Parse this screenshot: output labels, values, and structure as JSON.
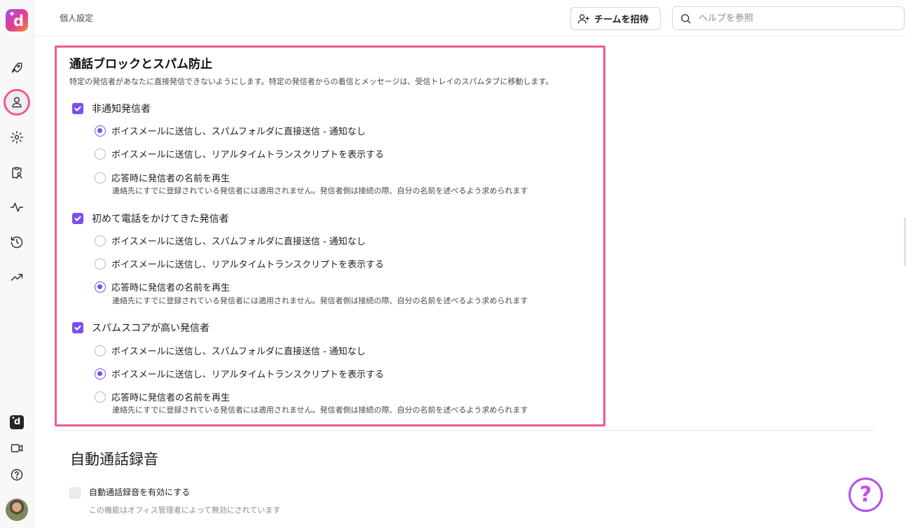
{
  "header": {
    "page_title": "個人設定",
    "invite_label": "チームを招待",
    "search_placeholder": "ヘルプを参照"
  },
  "sidebar": {
    "items": [
      {
        "icon": "rocket-icon"
      },
      {
        "icon": "user-icon",
        "active": true
      },
      {
        "icon": "gear-icon"
      },
      {
        "icon": "clipboard-user-icon"
      },
      {
        "icon": "activity-icon"
      },
      {
        "icon": "history-icon"
      },
      {
        "icon": "trending-up-icon"
      }
    ],
    "bottom": [
      {
        "icon": "dialpad-app-icon"
      },
      {
        "icon": "video-icon"
      },
      {
        "icon": "help-circle-icon"
      },
      {
        "icon": "avatar"
      }
    ]
  },
  "spam_section": {
    "title": "通話ブロックとスパム防止",
    "description": "特定の発信者があなたに直接発信できないようにします。特定の発信者からの着信とメッセージは、受信トレイのスパムタブに移動します。",
    "groups": [
      {
        "label": "非通知発信者",
        "checked": true,
        "options": [
          {
            "label": "ボイスメールに送信し、スパムフォルダに直接送信 - 通知なし",
            "selected": true
          },
          {
            "label": "ボイスメールに送信し、リアルタイムトランスクリプトを表示する",
            "selected": false
          },
          {
            "label": "応答時に発信者の名前を再生",
            "selected": false,
            "sub": "連絡先にすでに登録されている発信者には適用されません。発信者側は接続の際、自分の名前を述べるよう求められます"
          }
        ]
      },
      {
        "label": "初めて電話をかけてきた発信者",
        "checked": true,
        "options": [
          {
            "label": "ボイスメールに送信し、スパムフォルダに直接送信 - 通知なし",
            "selected": false
          },
          {
            "label": "ボイスメールに送信し、リアルタイムトランスクリプトを表示する",
            "selected": false
          },
          {
            "label": "応答時に発信者の名前を再生",
            "selected": true,
            "sub": "連絡先にすでに登録されている発信者には適用されません。発信者側は接続の際、自分の名前を述べるよう求められます"
          }
        ]
      },
      {
        "label": "スパムスコアが高い発信者",
        "checked": true,
        "options": [
          {
            "label": "ボイスメールに送信し、スパムフォルダに直接送信 - 通知なし",
            "selected": false
          },
          {
            "label": "ボイスメールに送信し、リアルタイムトランスクリプトを表示する",
            "selected": true
          },
          {
            "label": "応答時に発信者の名前を再生",
            "selected": false,
            "sub": "連絡先にすでに登録されている発信者には適用されません。発信者側は接続の際、自分の名前を述べるよう求められます"
          }
        ]
      }
    ]
  },
  "recording_section": {
    "title": "自動通話録音",
    "checkbox_label": "自動通話録音を有効にする",
    "checked": false,
    "disabled_note": "この機能はオフィス管理者によって無効にされています"
  },
  "help_fab": {
    "label": "?"
  },
  "colors": {
    "accent": "#7a4ff0",
    "highlight": "#ee5a93",
    "help_ring": "#b24ff0"
  }
}
